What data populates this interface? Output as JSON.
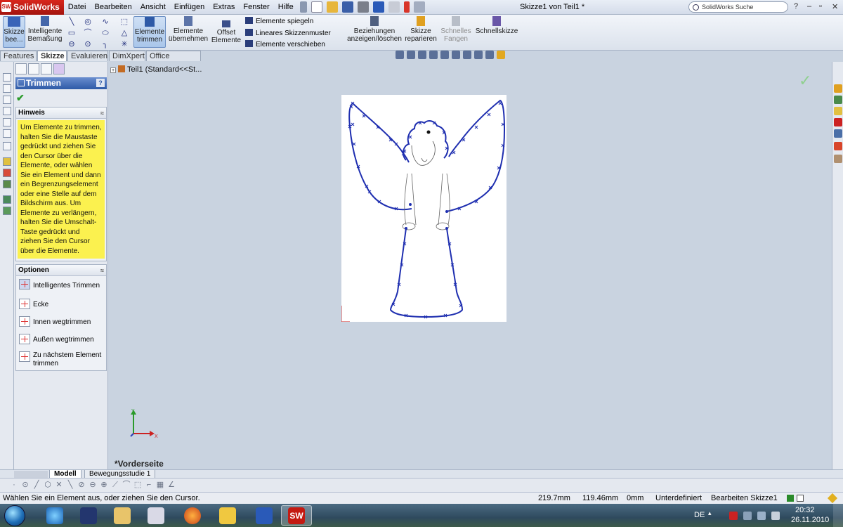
{
  "app": {
    "name": "SolidWorks",
    "logo_mark": "SW",
    "window_title": "Skizze1 von Teil1 *",
    "search_placeholder": "SolidWorks Suche",
    "window_controls": [
      "?",
      "–",
      "▫",
      "✕"
    ]
  },
  "menu": [
    "Datei",
    "Bearbeiten",
    "Ansicht",
    "Einfügen",
    "Extras",
    "Fenster",
    "Hilfe"
  ],
  "ribbon": {
    "sketch": {
      "line1": "Skizze",
      "line2": "bee..."
    },
    "smart_dim": {
      "line1": "Intelligente",
      "line2": "Bemaßung"
    },
    "trim": {
      "line1": "Elemente",
      "line2": "trimmen"
    },
    "convert": {
      "line1": "Elemente",
      "line2": "übernehmen"
    },
    "offset": {
      "line1": "Offset",
      "line2": "Elemente"
    },
    "mirror": "Elemente spiegeln",
    "linear_pattern": "Lineares Skizzenmuster",
    "move": "Elemente verschieben",
    "relations": {
      "line1": "Beziehungen",
      "line2": "anzeigen/löschen"
    },
    "repair": {
      "line1": "Skizze",
      "line2": "reparieren"
    },
    "quick_snaps": {
      "line1": "Schnelles",
      "line2": "Fangen"
    },
    "rapid_sketch": "Schnellskizze"
  },
  "tabs": [
    "Features",
    "Skizze",
    "Evaluieren",
    "DimXpert",
    "Office Produkte"
  ],
  "property_manager": {
    "title": "Trimmen",
    "help": "?",
    "check": "✔",
    "hint": {
      "heading": "Hinweis",
      "text": "Um Elemente zu trimmen, halten Sie die Maustaste gedrückt und ziehen Sie den Cursor über die Elemente, oder wählen Sie ein Element und dann ein Begrenzungselement oder eine Stelle auf dem Bildschirm aus. Um Elemente zu verlängern, halten Sie die Umschalt-Taste gedrückt und ziehen Sie den Cursor über die Elemente."
    },
    "options": {
      "heading": "Optionen",
      "items": [
        "Intelligentes Trimmen",
        "Ecke",
        "Innen wegtrimmen",
        "Außen wegtrimmen",
        "Zu nächstem Element trimmen"
      ]
    },
    "collapse": "≈"
  },
  "graphics": {
    "tree_node": "Teil1  (Standard<<St...",
    "tree_expand": "+",
    "view_name": "*Vorderseite",
    "confirm": "✓",
    "triad_x": "X",
    "triad_y": "Y"
  },
  "bottom_tabs": [
    "Modell",
    "Bewegungsstudie 1"
  ],
  "statusbar": {
    "message": "Wählen Sie ein Element aus, oder ziehen Sie den Cursor.",
    "x": "219.7mm",
    "y": "119.46mm",
    "z": "0mm",
    "state": "Unterdefiniert",
    "mode": "Bearbeiten Skizze1"
  },
  "taskbar": {
    "language": "DE",
    "time": "20:32",
    "date": "26.11.2010",
    "sw_label": "SW"
  },
  "colors": {
    "sketch_blue": "#1f2fb0",
    "hint_yellow": "#fbf14f",
    "accent": "#2e5aa7"
  }
}
